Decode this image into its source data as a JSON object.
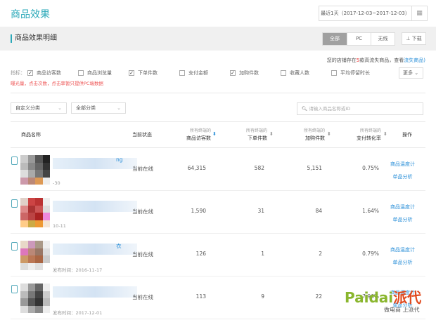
{
  "page_title": "商品效果",
  "date_range": "最近1天（2017-12-03~2017-12-03）",
  "section_title": "商品效果明细",
  "device_tabs": [
    "全部",
    "PC",
    "无线"
  ],
  "download_label": "下载",
  "notice": {
    "prefix": "您的店铺存在",
    "count": "5",
    "middle": "款高流失商品，查看",
    "link": "流失商品"
  },
  "metrics_label": "指标：",
  "metrics": [
    {
      "label": "商品访客数",
      "checked": true
    },
    {
      "label": "商品浏览量",
      "checked": false
    },
    {
      "label": "下单件数",
      "checked": true
    },
    {
      "label": "支付金额",
      "checked": false
    },
    {
      "label": "加购件数",
      "checked": true
    },
    {
      "label": "收藏人数",
      "checked": false
    },
    {
      "label": "平均停留时长",
      "checked": false
    }
  ],
  "more_label": "更多",
  "warning": "曝光量，点击次数，点击率暂只提供PC端数据",
  "filters": {
    "custom": "自定义分类",
    "all": "全部分类",
    "search_placeholder": "请输入商品名称或ID"
  },
  "table": {
    "headers": {
      "name": "商品名称",
      "status": "当前状态",
      "prefix": "所有终端的",
      "visitors": "商品访客数",
      "orders": "下单件数",
      "cart": "加购件数",
      "rate": "支付转化率",
      "ops": "操作"
    },
    "rows": [
      {
        "title_frag": "ng",
        "pub": "-30",
        "status": "当前在线",
        "visitors": "64,315",
        "orders": "582",
        "cart": "5,151",
        "rate": "0.75%"
      },
      {
        "title_frag": "",
        "pub": "10-11",
        "status": "当前在线",
        "visitors": "1,590",
        "orders": "31",
        "cart": "84",
        "rate": "1.64%"
      },
      {
        "title_frag": "衣",
        "pub": "发布时间：2016-11-17",
        "status": "当前在线",
        "visitors": "126",
        "orders": "1",
        "cart": "2",
        "rate": "0.79%"
      },
      {
        "title_frag": "",
        "pub": "发布时间：2017-12-01",
        "status": "当前在线",
        "visitors": "113",
        "orders": "9",
        "cart": "22",
        "rate": "7.96%"
      }
    ],
    "op_labels": {
      "temp": "商品温度计",
      "analysis": "单品分析"
    }
  },
  "watermark": {
    "brand": "Paidai",
    "cn": "派代",
    "slogan": "做电商 上派代"
  },
  "colors": {
    "accent": "#2aa8b8",
    "link": "#2a8fd8",
    "warning": "#e33"
  }
}
